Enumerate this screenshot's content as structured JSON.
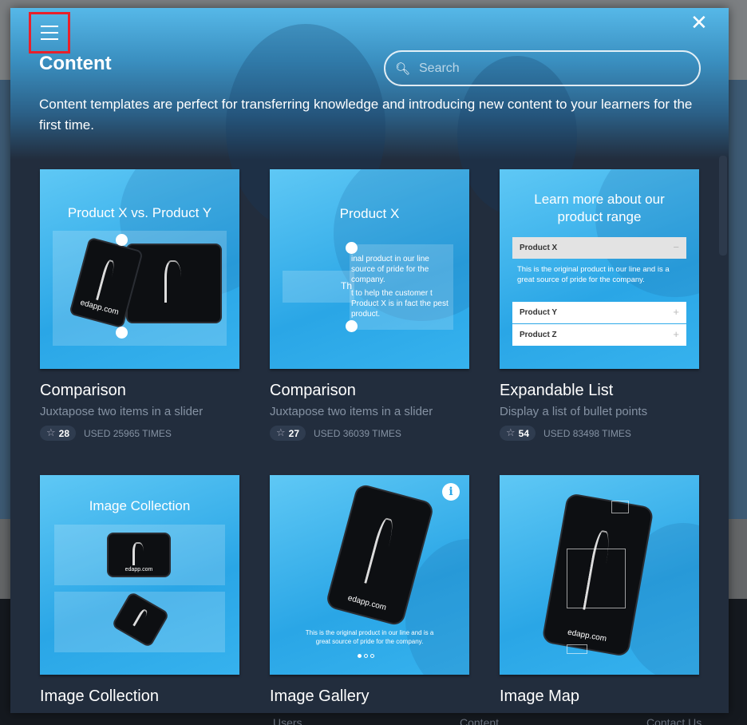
{
  "modal": {
    "title": "Content",
    "description": "Content templates are perfect for transferring knowledge and introducing new content to your learners for the first time.",
    "search_placeholder": "Search",
    "search_value": "",
    "close_label": "✕",
    "menu_icon": "hamburger-icon",
    "highlight_color": "#e8202a"
  },
  "cards": [
    {
      "name": "Comparison",
      "sub": "Juxtapose two items in a slider",
      "stars": "28",
      "used": "USED 25965 TIMES",
      "thumb_title": "Product X vs. Product Y",
      "brand": "edapp.com"
    },
    {
      "name": "Comparison",
      "sub": "Juxtapose two items in a slider",
      "stars": "27",
      "used": "USED 36039 TIMES",
      "thumb_title": "Product X",
      "thumb_text_a": "inal product in our line source of pride for the company.",
      "thumb_text_b": "t to help the customer t Product X is in fact the pest product.",
      "thumb_text_c": "Th"
    },
    {
      "name": "Expandable List",
      "sub": "Display a list of bullet points",
      "stars": "54",
      "used": "USED 83498 TIMES",
      "thumb_title": "Learn more about our product range",
      "items": [
        "Product X",
        "Product Y",
        "Product Z"
      ],
      "item_body": "This is the original product in our line and is a great source of pride for the company.",
      "minus": "−",
      "plus": "+"
    },
    {
      "name": "Image Collection",
      "thumb_title": "Image Collection",
      "brand": "edapp.com"
    },
    {
      "name": "Image Gallery",
      "thumb_text": "This is the original product in our line and is a great source of pride for the company.",
      "brand": "edapp.com",
      "info": "i"
    },
    {
      "name": "Image Map",
      "brand": "edapp.com"
    }
  ],
  "footer": {
    "links": [
      "Users",
      "Content",
      "Contact Us"
    ]
  }
}
